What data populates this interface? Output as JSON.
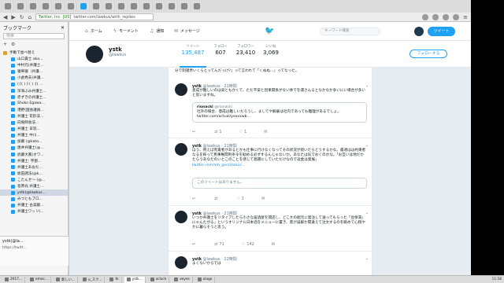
{
  "browser": {
    "url_secure_label": "Twitter, Inc. [US]",
    "url": "twitter.com/lawkus/with_replies"
  },
  "sidebar": {
    "title": "ブックマーク",
    "close": "✕",
    "search_placeholder": "検索",
    "tools": [
      "+",
      "⚙"
    ],
    "items": [
      {
        "label": "手動で並べ替え",
        "type": "folder"
      },
      {
        "label": "山口貴士 aka..."
      },
      {
        "label": "中村元(弁護士..."
      },
      {
        "label": "寝華寝（弁護..."
      },
      {
        "label": "小倉秀夫(弁護..."
      },
      {
        "label": "(:[( ) ]:( ) :[( ..."
      },
      {
        "label": "深海ぶみ弁護士..."
      },
      {
        "label": "赤ずきの弁護士..."
      },
      {
        "label": "Shoko Egawa..."
      },
      {
        "label": "港野(国会議員..."
      },
      {
        "label": "弁護士 花形法..."
      },
      {
        "label": "向堀師会法..."
      },
      {
        "label": "弁護士 日羽..."
      },
      {
        "label": "弁護士 中川..."
      },
      {
        "label": "加藤 (@kato..."
      },
      {
        "label": "唐井弁護士(@..."
      },
      {
        "label": "武藤大風(オワ..."
      },
      {
        "label": "弁護士: 宇部..."
      },
      {
        "label": "弁護士あおだ..."
      },
      {
        "label": "坂田諸法(@k..."
      },
      {
        "label": "こたんせ〜 (@..."
      },
      {
        "label": "島原光 弁護士..."
      },
      {
        "label": "ystk(@lawkus...",
        "selected": true
      },
      {
        "label": "みつともブロ..."
      },
      {
        "label": "弁護士 古美鏡..."
      },
      {
        "label": "弁護士ワッリ(..."
      }
    ],
    "preview_name": "ystk(@la...",
    "preview_url": "https://twitt..."
  },
  "twitter_nav": {
    "home": "ホーム",
    "moments": "モーメント",
    "notifications": "通知",
    "messages": "メッセージ",
    "search_placeholder": "キーワード検索",
    "tweet_button": "ツイート"
  },
  "profile": {
    "name": "ystk",
    "handle": "@lawkus",
    "stats": [
      {
        "label": "ツイート",
        "value": "135,487"
      },
      {
        "label": "フォロー",
        "value": "607"
      },
      {
        "label": "フォロワー",
        "value": "23,410"
      },
      {
        "label": "いいね",
        "value": "3,069"
      }
    ],
    "follow_button": "フォローする"
  },
  "timeline": {
    "top_fragment": "分で刺諸界いくらとってんだっけ?」って言われて「くぬぬ…」ってなった。",
    "tweets": [
      {
        "name": "ystk",
        "handle": "@lawkus",
        "time": "21時間",
        "text": "意成が難しいのは高ともかくて、ただ不安と因果関係がない体でを運さんるとなかなか争いにい場合が多いと思いますね。",
        "quote": {
          "name": "rionacki",
          "handle": "@rionacki",
          "text": "社外の場合、意成は難しいだろうし、ましてや解雇は社内であっても難理があるでしょ。",
          "link": "twitter.com/actual/yexxxwb..."
        },
        "actions": {
          "reply": "",
          "retweet": "1",
          "like": "1"
        }
      },
      {
        "name": "ystk",
        "handle": "@lawkus",
        "time": "21時間",
        "text": "ほう、例えば有責者があるとかも仕事に行けなくなってその状況が続いたらどうするかな。最適はは約束者なるを稼って民事権間利条令を勧める必ずするんじゃないか。あなたは気でおくのかな。「お互いは地だかたらうあなたのいとこのことを感じて発題にしていただけなので返金は発展」",
        "link": "twitter.com/mh_gen/status/...",
        "quote": {
          "unavailable": "このツイートはありません。"
        },
        "actions": {
          "reply": "",
          "retweet": "",
          "like": "1"
        }
      },
      {
        "name": "ystk",
        "handle": "@lawkus",
        "time": "21時間",
        "text": "いつか弁護士をリタイアしたら小さな居酒屋を開店し、どこかの組元に発注して送ってもらった「豆保湯」にゃんたがる」というオリジナル日本酒をメニューに置き、客が誤解か間違えて注文するのを眺めて心穏やかに暮らそうと思う。",
        "actions": {
          "reply": "",
          "retweet": "71",
          "like": "142"
        }
      },
      {
        "name": "ystk",
        "handle": "@lawkus",
        "time": "22時間",
        "text": "よくないからでは",
        "actions": {
          "reply": "",
          "retweet": "",
          "like": ""
        }
      }
    ]
  },
  "taskbar": {
    "tasks": [
      "2017...",
      "emac...",
      "新しい...",
      "a_スク...",
      "tk",
      "ystk...",
      "xclock",
      "xeyes",
      "xlogo"
    ],
    "active_index": 5,
    "clock": "11:58"
  }
}
